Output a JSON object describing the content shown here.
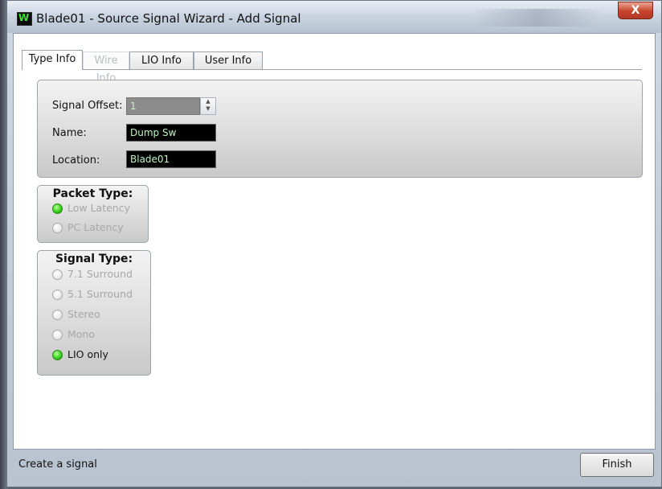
{
  "window": {
    "title": "Blade01 - Source Signal Wizard - Add Signal",
    "icon_letter": "W",
    "close_glyph": "X",
    "accent": "#3de23d",
    "close_color": "#c8432c"
  },
  "tabs": [
    {
      "label": "Type Info",
      "active": true,
      "enabled": true
    },
    {
      "label": "Wire Info",
      "active": false,
      "enabled": false
    },
    {
      "label": "LIO Info",
      "active": false,
      "enabled": true
    },
    {
      "label": "User Info",
      "active": false,
      "enabled": true
    }
  ],
  "form": {
    "offset_label": "Signal Offset:",
    "offset_value": "1",
    "name_label": "Name:",
    "name_value": "Dump Sw",
    "location_label": "Location:",
    "location_value": "Blade01"
  },
  "packet_type": {
    "title": "Packet Type:",
    "options": [
      {
        "label": "Low Latency",
        "selected": true
      },
      {
        "label": "PC Latency",
        "selected": false
      }
    ]
  },
  "signal_type": {
    "title": "Signal Type:",
    "options": [
      {
        "label": "7.1 Surround",
        "selected": false
      },
      {
        "label": "5.1 Surround",
        "selected": false
      },
      {
        "label": "Stereo",
        "selected": false
      },
      {
        "label": "Mono",
        "selected": false
      },
      {
        "label": "LIO only",
        "selected": true
      }
    ]
  },
  "status": {
    "text": "Create a signal",
    "finish_label": "Finish"
  }
}
